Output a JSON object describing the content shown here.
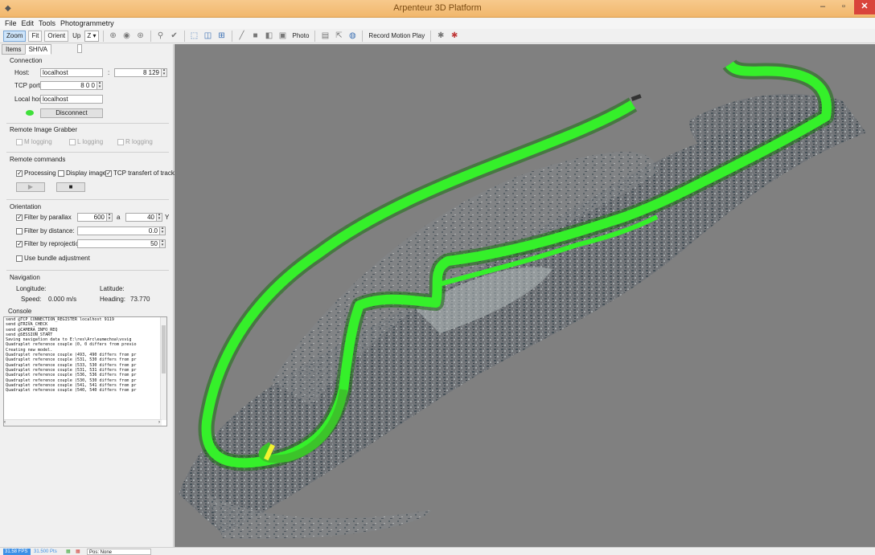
{
  "window": {
    "title": "Arpenteur 3D Platform"
  },
  "menu": [
    "File",
    "Edit",
    "Tools",
    "Photogrammetry"
  ],
  "toolbar": {
    "zoom_button": "Zoom",
    "fit_button": "Fit",
    "orient_button": "Orient",
    "up_label": "Up",
    "up_value": "Z",
    "photo_button": "Photo",
    "record_label": "Record Motion Play"
  },
  "tabs": {
    "items": [
      "Items",
      "SHIVA"
    ],
    "active": 1
  },
  "connection": {
    "title": "Connection",
    "host_label": "Host:",
    "host_value": "localhost",
    "host_sep": ":",
    "port_value": "8 129",
    "tcp_label": "TCP port:",
    "tcp_value": "8 0 0",
    "local_label": "Local host:",
    "local_value": "localhost",
    "disconnect_label": "Disconnect",
    "status_color": "#3fe03a"
  },
  "grabber": {
    "title": "Remote Image Grabber",
    "options": [
      "M logging",
      "L logging",
      "R logging"
    ]
  },
  "commands": {
    "title": "Remote commands",
    "processing": "Processing",
    "display_images": "Display images",
    "tcp_transfert": "TCP transfert of tracks"
  },
  "orientation": {
    "title": "Orientation",
    "parallax_label": "Filter by parallax",
    "parallax_min": "600",
    "parallax_sep": "a",
    "parallax_max": "40",
    "parallax_unit": "Y",
    "distance_label": "Filter by distance:",
    "distance_value": "0.0",
    "reproj_label": "Filter by reprojection:",
    "reproj_value": "50",
    "bundle_label": "Use bundle adjustment"
  },
  "navigation": {
    "title": "Navigation",
    "longitude_label": "Longitude:",
    "latitude_label": "Latitude:",
    "speed_label": "Speed:",
    "speed_value": "0.000 m/s",
    "heading_label": "Heading:",
    "heading_value": "73.770"
  },
  "console": {
    "title": "Console",
    "lines": [
      "send @TCP_CONNECTION_REGISTER localhost 9119",
      "send @TRIVA_CHECK",
      "send @CAMERA_INFO_REQ",
      "send @SESSION_START",
      "Saving navigation data to E:\\res\\Arc\\eumechoa\\vsvig",
      "Quadruplet reference couple (0, 0 differs from previo",
      "Creating new model.",
      "Quadruplet reference couple (493, 490 differs from pr",
      "Quadruplet reference couple (531, 530 differs from pr",
      "Quadruplet reference couple (533, 530 differs from pr",
      "Quadruplet reference couple (531, 531 differs from pr",
      "Quadruplet reference couple (536, 536 differs from pr",
      "Quadruplet reference couple (530, 530 differs from pr",
      "Quadruplet reference couple (541, 541 differs from pr",
      "Quadruplet reference couple (540, 540 differs from pr"
    ]
  },
  "statusbar": {
    "fps": "31.58 FPS",
    "frame": "31.500 Pts",
    "pos": "Pos: None"
  }
}
